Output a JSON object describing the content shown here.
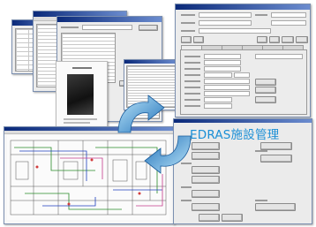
{
  "brand_title": "EDRAS施設管理",
  "colors": {
    "brand": "#1b8fd6",
    "arrow_light": "#8fd3f5",
    "arrow_dark": "#1e6fb8",
    "titlebar": "#0b2a7a"
  },
  "icons": [
    "cycle-arrow-top",
    "cycle-arrow-bottom"
  ]
}
